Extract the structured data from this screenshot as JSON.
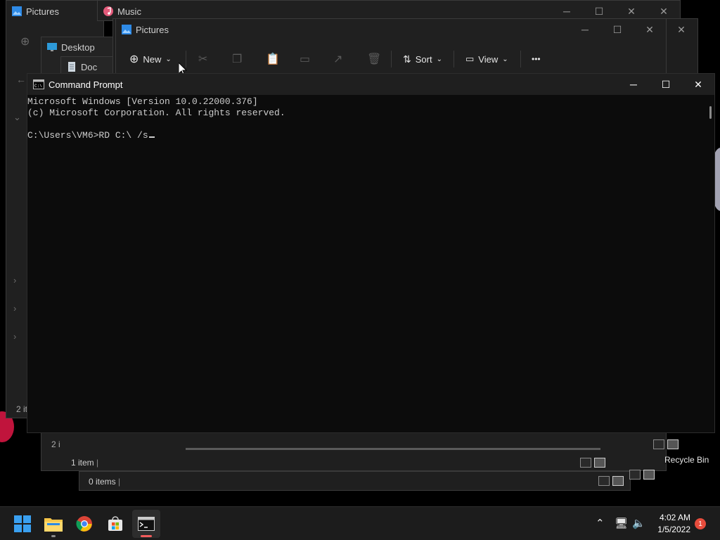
{
  "windows": {
    "back_pictures": {
      "title": "Pictures",
      "status": "2 it"
    },
    "music": {
      "title": "Music"
    },
    "desktop": {
      "title": "Desktop"
    },
    "documents": {
      "title": "Doc"
    },
    "mid": {
      "status": "2 i",
      "status2": "1 item"
    },
    "lower": {
      "status": "0 items"
    },
    "front_pictures": {
      "title": "Pictures",
      "toolbar": {
        "new_label": "New",
        "sort_label": "Sort",
        "view_label": "View",
        "more_label": "•••"
      }
    }
  },
  "cmd": {
    "title": "Command Prompt",
    "lines": [
      "Microsoft Windows [Version 10.0.22000.376]",
      "(c) Microsoft Corporation. All rights reserved.",
      "",
      "C:\\Users\\VM6>RD C:\\ /s"
    ]
  },
  "desktop_icons": {
    "recycle_bin": "Recycle Bin"
  },
  "taskbar": {
    "clock_time": "4:02 AM",
    "clock_date": "1/5/2022",
    "notification_count": "1"
  },
  "colors": {
    "accent_blue": "#0078d4",
    "taskbar": "#1c1c1c",
    "console_bg": "#0c0c0c"
  }
}
